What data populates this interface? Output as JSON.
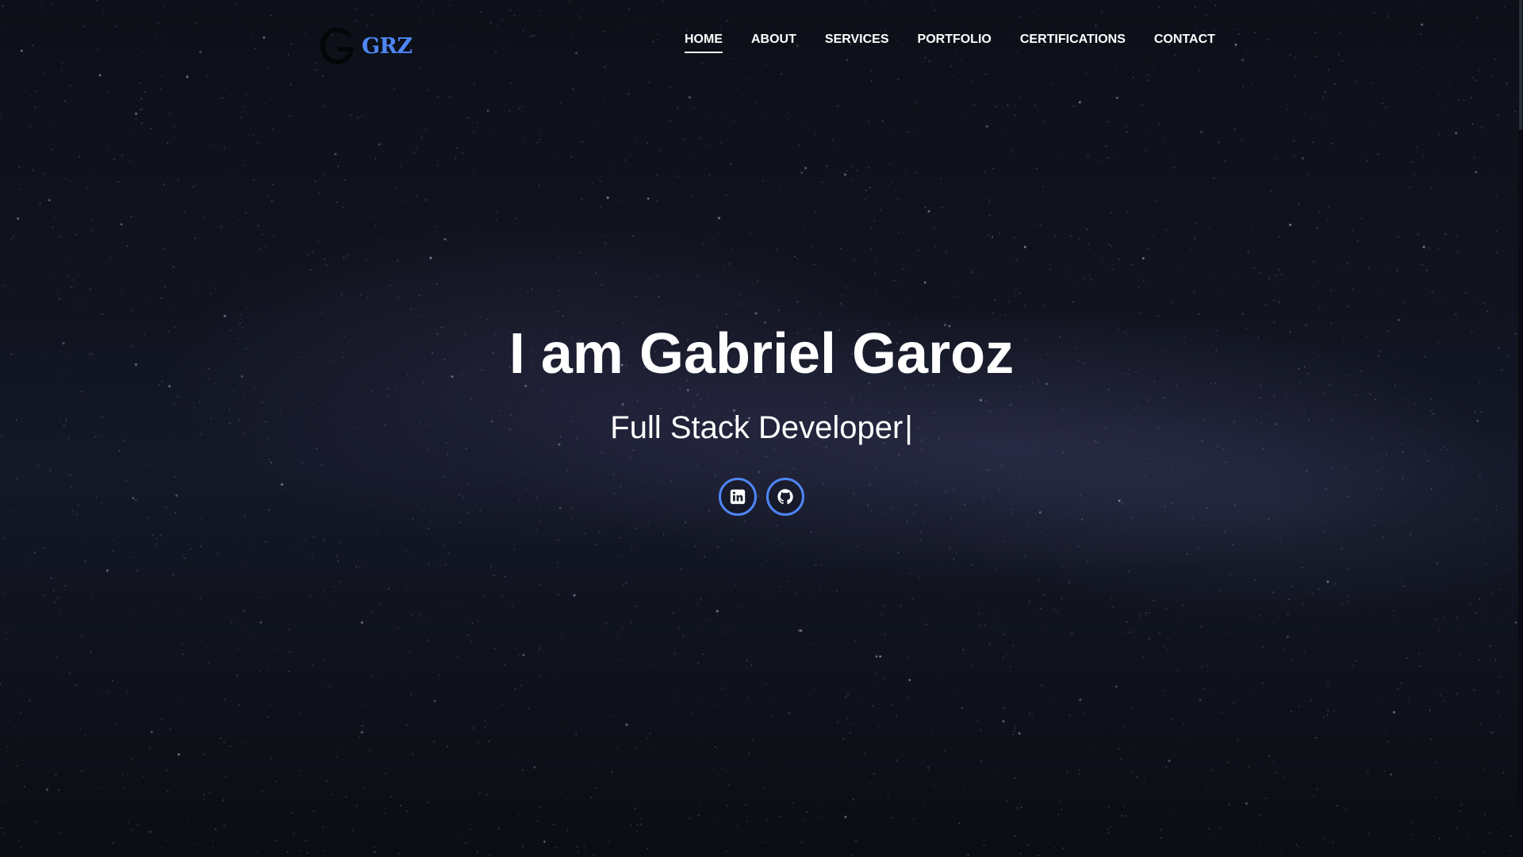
{
  "brand": {
    "logo_text": "GRZ",
    "accent_color": "#4f86f7",
    "logo_mark_icon": "g-letter-icon"
  },
  "nav": {
    "items": [
      {
        "label": "HOME",
        "active": true
      },
      {
        "label": "ABOUT",
        "active": false
      },
      {
        "label": "SERVICES",
        "active": false
      },
      {
        "label": "PORTFOLIO",
        "active": false
      },
      {
        "label": "CERTIFICATIONS",
        "active": false
      },
      {
        "label": "CONTACT",
        "active": false
      }
    ]
  },
  "hero": {
    "title": "I am Gabriel Garoz",
    "subtitle": "Full Stack Developer",
    "cursor": "|"
  },
  "social": {
    "links": [
      {
        "icon": "linkedin-icon"
      },
      {
        "icon": "github-icon"
      }
    ]
  },
  "theme": {
    "background": "starry-night-sky",
    "text_color": "#ffffff"
  }
}
